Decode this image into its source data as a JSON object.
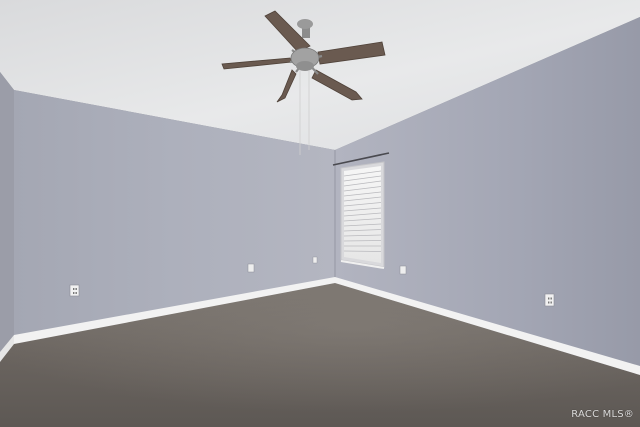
{
  "watermark": {
    "text": "RACC MLS®"
  },
  "colors": {
    "ceiling": "#e2e3e5",
    "left_wall": "#a6a9b6",
    "right_wall": "#a1a4b2",
    "far_left_wall": "#9c9ea9",
    "carpet": "#6b6560",
    "baseboard": "#f4f4f4",
    "fan_blade": "#6a5a50",
    "fan_metal": "#9a9a9a"
  },
  "icons": {
    "ceiling_fan": "ceiling-fan-icon",
    "window": "window-blinds-icon",
    "outlet": "electrical-outlet-icon"
  }
}
